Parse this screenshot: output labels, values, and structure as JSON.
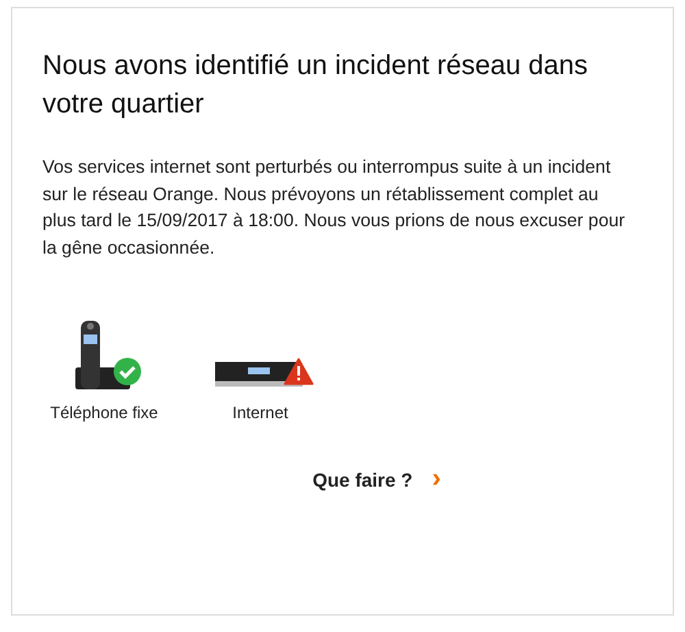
{
  "title": "Nous avons identifié un incident réseau dans votre quartier",
  "message": "Vos services internet sont perturbés ou interrompus suite à un incident sur le réseau Orange. Nous prévoyons un rétablissement complet au plus tard le 15/09/2017 à 18:00. Nous vous prions de nous excuser pour la gêne occasionnée.",
  "services": [
    {
      "label": "Téléphone fixe",
      "kind": "phone",
      "working": true
    },
    {
      "label": "Internet",
      "kind": "box",
      "working": false
    }
  ],
  "action": {
    "label": "Que faire ?",
    "icon": "›"
  }
}
